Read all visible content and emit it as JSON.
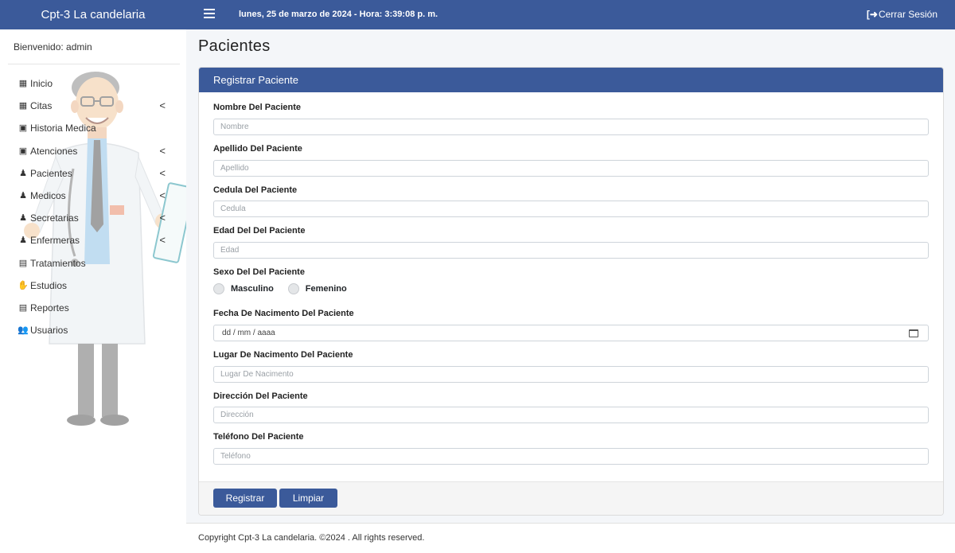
{
  "topbar": {
    "brand": "Cpt-3 La candelaria",
    "datetime": "lunes, 25 de marzo de 2024 - Hora: 3:39:08 p. m.",
    "logout_label": "Cerrar Sesión"
  },
  "sidebar": {
    "welcome": "Bienvenido: admin",
    "items": [
      {
        "label": "Inicio",
        "icon": "hospital-icon"
      },
      {
        "label": "Citas",
        "icon": "calendar-icon"
      },
      {
        "label": "Historia Medica",
        "icon": "medical-record-icon"
      },
      {
        "label": "Atenciones",
        "icon": "user-injured-icon"
      },
      {
        "label": "Pacientes",
        "icon": "person-icon"
      },
      {
        "label": "Medicos",
        "icon": "user-doctor-icon"
      },
      {
        "label": "Secretarias",
        "icon": "person-icon"
      },
      {
        "label": "Enfermeras",
        "icon": "user-nurse-icon"
      },
      {
        "label": "Tratamientos",
        "icon": "trash-box-icon"
      },
      {
        "label": "Estudios",
        "icon": "hand-holding-medical-icon"
      },
      {
        "label": "Reportes",
        "icon": "file-medical-icon"
      },
      {
        "label": "Usuarios",
        "icon": "users-icon"
      }
    ]
  },
  "page": {
    "title": "Pacientes"
  },
  "form": {
    "header": "Registrar Paciente",
    "nombre_label": "Nombre Del Paciente",
    "nombre_placeholder": "Nombre",
    "apellido_label": "Apellido Del Paciente",
    "apellido_placeholder": "Apellido",
    "cedula_label": "Cedula Del Paciente",
    "cedula_placeholder": "Cedula",
    "edad_label": "Edad Del Del Paciente",
    "edad_placeholder": "Edad",
    "sexo_label": "Sexo Del Del Paciente",
    "sexo_options": [
      "Masculino",
      "Femenino"
    ],
    "fecha_label": "Fecha De Nacimento Del Paciente",
    "fecha_value": "dd / mm / aaaa",
    "lugar_label": "Lugar De Nacimento Del Paciente",
    "lugar_placeholder": "Lugar De Nacimento",
    "direccion_label": "Dirección Del Paciente",
    "direccion_placeholder": "Dirección",
    "telefono_label": "Teléfono Del Paciente",
    "telefono_placeholder": "Teléfono",
    "submit_label": "Registrar",
    "clear_label": "Limpiar"
  },
  "footer": {
    "copyright": "Copyright Cpt-3 La candelaria. ©2024 . All rights reserved."
  },
  "colors": {
    "primary": "#3b5a9a",
    "background": "#f4f6f9"
  }
}
